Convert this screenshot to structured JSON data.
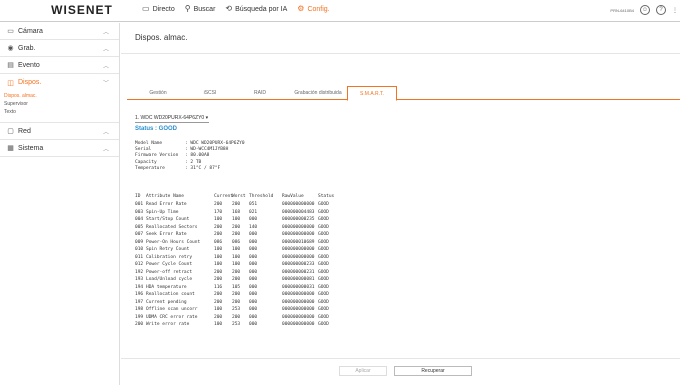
{
  "brand": "WISENET",
  "topnav": [
    {
      "icon": "monitor-icon",
      "glyph": "▭",
      "label": "Directo"
    },
    {
      "icon": "search-icon",
      "glyph": "⚲",
      "label": "Buscar"
    },
    {
      "icon": "ai-search-icon",
      "glyph": "⟲",
      "label": "Búsqueda por IA"
    },
    {
      "icon": "gear-icon",
      "glyph": "⚙",
      "label": "Config."
    }
  ],
  "topright": {
    "model": "PRN-6410B4",
    "user_icon": "user-icon",
    "help_icon": "help-icon",
    "more_icon": "more-icon"
  },
  "sidebar": {
    "items": [
      {
        "label": "Cámara",
        "glyph": "▭",
        "icon": "camera-icon"
      },
      {
        "label": "Grab.",
        "glyph": "◉",
        "icon": "record-icon"
      },
      {
        "label": "Evento",
        "glyph": "▤",
        "icon": "event-icon"
      },
      {
        "label": "Dispos.",
        "glyph": "◫",
        "icon": "device-icon"
      },
      {
        "label": "Red",
        "glyph": "▢",
        "icon": "network-icon"
      },
      {
        "label": "Sistema",
        "glyph": "▦",
        "icon": "system-icon"
      }
    ],
    "subitems": [
      "Dispos. almac.",
      "Supervisor",
      "Texto"
    ]
  },
  "page_title": "Dispos. almac.",
  "tabs": [
    "Gestión",
    "iSCSI",
    "RAID",
    "Grabación distribuida",
    "S.M.A.R.T."
  ],
  "disk_select": "1. WDC WD20PURX-64P6ZY0",
  "status": "Status : GOOD",
  "info": [
    {
      "key": "Model Name",
      "value": ": WDC WD20PURX-64P6ZY0"
    },
    {
      "key": "Serial",
      "value": ":       WD-WCC4M1JYB8H"
    },
    {
      "key": "Firmware Version",
      "value": ": 80.00A8"
    },
    {
      "key": "Capacity",
      "value": ": 2 TB"
    },
    {
      "key": "Temperature",
      "value": ": 31°C / 87°F"
    }
  ],
  "attr_headers": {
    "id": "ID",
    "name": "Attribute Name",
    "current": "Current",
    "worst": "Worst",
    "threshold": "Threshold",
    "raw": "RawValue",
    "status": "Status"
  },
  "attributes": [
    [
      "001",
      "Read Error Rate",
      "200",
      "200",
      "051",
      "000000000000",
      "GOOD"
    ],
    [
      "003",
      "Spin-Up Time",
      "170",
      "168",
      "021",
      "000000004483",
      "GOOD"
    ],
    [
      "004",
      "Start/Stop Count",
      "100",
      "100",
      "000",
      "000000000235",
      "GOOD"
    ],
    [
      "005",
      "Reallocated Sectors",
      "200",
      "200",
      "140",
      "000000000000",
      "GOOD"
    ],
    [
      "007",
      "Seek Error Rate",
      "200",
      "200",
      "000",
      "000000000000",
      "GOOD"
    ],
    [
      "009",
      "Power-On Hours Count",
      "086",
      "086",
      "000",
      "000000010689",
      "GOOD"
    ],
    [
      "010",
      "Spin Retry Count",
      "100",
      "100",
      "000",
      "000000000000",
      "GOOD"
    ],
    [
      "011",
      "Calibration retry",
      "100",
      "100",
      "000",
      "000000000000",
      "GOOD"
    ],
    [
      "012",
      "Power Cycle Count",
      "100",
      "100",
      "000",
      "000000000233",
      "GOOD"
    ],
    [
      "192",
      "Power-off retract",
      "200",
      "200",
      "000",
      "000000000231",
      "GOOD"
    ],
    [
      "193",
      "Load/Unload cycle",
      "200",
      "200",
      "000",
      "000000000081",
      "GOOD"
    ],
    [
      "194",
      "HDA temperature",
      "116",
      "105",
      "000",
      "000000000031",
      "GOOD"
    ],
    [
      "196",
      "Reallocation count",
      "200",
      "200",
      "000",
      "000000000000",
      "GOOD"
    ],
    [
      "197",
      "Current pending",
      "200",
      "200",
      "000",
      "000000000000",
      "GOOD"
    ],
    [
      "198",
      "Offline scan uncorr",
      "100",
      "253",
      "000",
      "000000000000",
      "GOOD"
    ],
    [
      "199",
      "UDMA CRC error rate",
      "200",
      "200",
      "000",
      "000000000000",
      "GOOD"
    ],
    [
      "200",
      "Write error rate",
      "100",
      "253",
      "000",
      "000000000000",
      "GOOD"
    ]
  ],
  "buttons": {
    "apply": "Aplicar",
    "recover": "Recuperar"
  },
  "colors": {
    "accent": "#f37321",
    "status": "#2a8fcf"
  }
}
